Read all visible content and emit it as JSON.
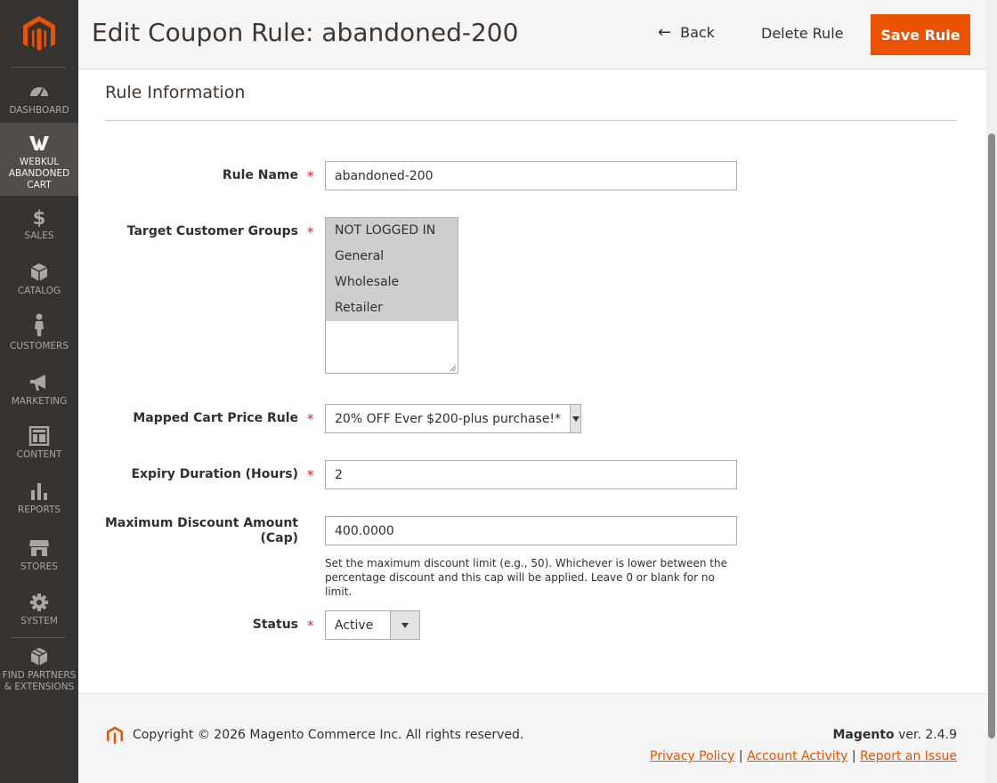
{
  "sidebar": {
    "items": [
      {
        "label": "DASHBOARD",
        "icon": "dashboard-icon"
      },
      {
        "label": "WEBKUL ABANDONED CART",
        "icon": "webkul-icon"
      },
      {
        "label": "SALES",
        "icon": "dollar-icon"
      },
      {
        "label": "CATALOG",
        "icon": "box-icon"
      },
      {
        "label": "CUSTOMERS",
        "icon": "person-icon"
      },
      {
        "label": "MARKETING",
        "icon": "megaphone-icon"
      },
      {
        "label": "CONTENT",
        "icon": "layout-icon"
      },
      {
        "label": "REPORTS",
        "icon": "bar-chart-icon"
      },
      {
        "label": "STORES",
        "icon": "store-icon"
      },
      {
        "label": "SYSTEM",
        "icon": "gear-icon"
      },
      {
        "label": "FIND PARTNERS & EXTENSIONS",
        "icon": "cubes-icon"
      }
    ]
  },
  "header": {
    "title": "Edit Coupon Rule: abandoned-200",
    "back_label": "Back",
    "delete_label": "Delete Rule",
    "save_label": "Save Rule"
  },
  "form": {
    "section_title": "Rule Information",
    "rule_name": {
      "label": "Rule Name",
      "value": "abandoned-200"
    },
    "customer_groups": {
      "label": "Target Customer Groups",
      "options": [
        "NOT LOGGED IN",
        "General",
        "Wholesale",
        "Retailer"
      ]
    },
    "cart_price_rule": {
      "label": "Mapped Cart Price Rule",
      "value": "20% OFF Ever $200-plus purchase!*"
    },
    "expiry": {
      "label": "Expiry Duration (Hours)",
      "value": "2"
    },
    "max_discount": {
      "label_line1": "Maximum Discount Amount",
      "label_line2": "(Cap)",
      "value": "400.0000",
      "note": "Set the maximum discount limit (e.g., 50). Whichever is lower between the percentage discount and this cap will be applied. Leave 0 or blank for no limit."
    },
    "status": {
      "label": "Status",
      "value": "Active"
    },
    "required_mark": "*"
  },
  "footer": {
    "copyright": "Copyright © 2026 Magento Commerce Inc. All rights reserved.",
    "brand": "Magento",
    "version": " ver. 2.4.9",
    "privacy": "Privacy Policy",
    "activity": " Account Activity",
    "report": "Report an Issue",
    "sep": " | "
  },
  "colors": {
    "accent": "#eb5202",
    "sidebar_bg": "#373330",
    "sidebar_active": "#524d49",
    "required": "#e22626"
  }
}
